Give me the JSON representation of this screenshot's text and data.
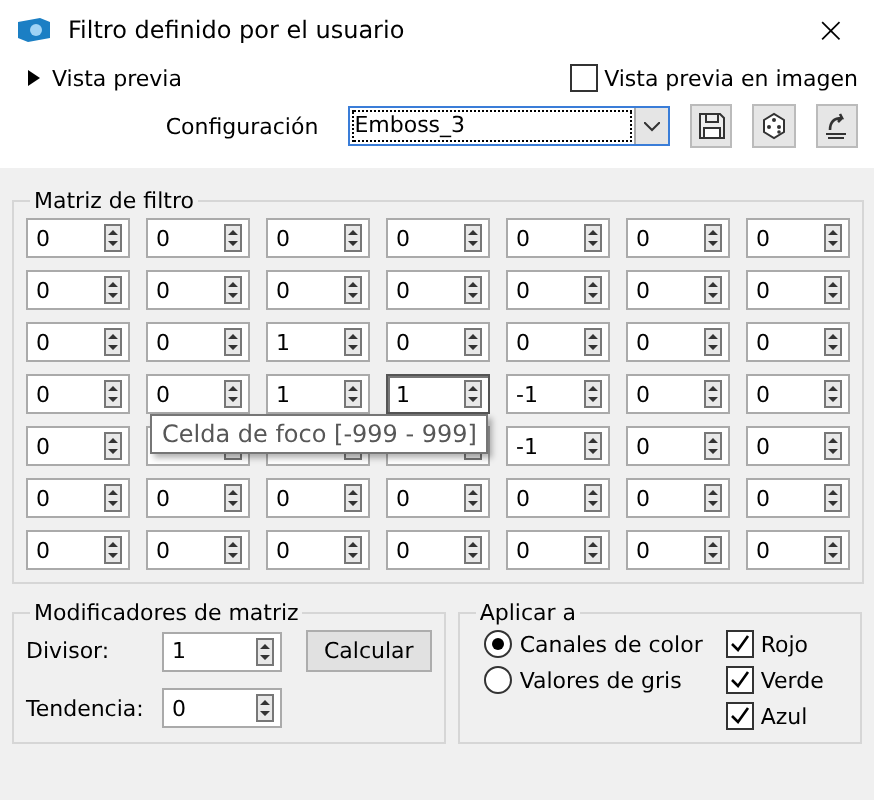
{
  "window": {
    "title": "Filtro definido por el usuario",
    "close": "×"
  },
  "preview": {
    "label": "Vista previa",
    "expanded": false
  },
  "image_preview": {
    "label": "Vista previa en imagen",
    "checked": false
  },
  "preset": {
    "label": "Configuración",
    "value": "Emboss_3"
  },
  "matrix": {
    "title": "Matriz de filtro",
    "rows": [
      [
        {
          "value": "0",
          "focused": false
        },
        {
          "value": "0",
          "focused": false
        },
        {
          "value": "0",
          "focused": false
        },
        {
          "value": "0",
          "focused": false
        },
        {
          "value": "0",
          "focused": false
        },
        {
          "value": "0",
          "focused": false
        },
        {
          "value": "0",
          "focused": false
        }
      ],
      [
        {
          "value": "0",
          "focused": false
        },
        {
          "value": "0",
          "focused": false
        },
        {
          "value": "0",
          "focused": false
        },
        {
          "value": "0",
          "focused": false
        },
        {
          "value": "0",
          "focused": false
        },
        {
          "value": "0",
          "focused": false
        },
        {
          "value": "0",
          "focused": false
        }
      ],
      [
        {
          "value": "0",
          "focused": false
        },
        {
          "value": "0",
          "focused": false
        },
        {
          "value": "1",
          "focused": false
        },
        {
          "value": "0",
          "focused": false
        },
        {
          "value": "0",
          "focused": false
        },
        {
          "value": "0",
          "focused": false
        },
        {
          "value": "0",
          "focused": false
        }
      ],
      [
        {
          "value": "0",
          "focused": false
        },
        {
          "value": "0",
          "focused": false
        },
        {
          "value": "1",
          "focused": false
        },
        {
          "value": "1",
          "focused": true
        },
        {
          "value": "-1",
          "focused": false
        },
        {
          "value": "0",
          "focused": false
        },
        {
          "value": "0",
          "focused": false
        }
      ],
      [
        {
          "value": "0",
          "focused": false
        },
        {
          "focused": false
        },
        {
          "focused": false
        },
        {
          "focused": false
        },
        {
          "value": "-1",
          "focused": false
        },
        {
          "value": "0",
          "focused": false
        },
        {
          "value": "0",
          "focused": false
        }
      ],
      [
        {
          "value": "0",
          "focused": false
        },
        {
          "value": "0",
          "focused": false
        },
        {
          "value": "0",
          "focused": false
        },
        {
          "value": "0",
          "focused": false
        },
        {
          "value": "0",
          "focused": false
        },
        {
          "value": "0",
          "focused": false
        },
        {
          "value": "0",
          "focused": false
        }
      ],
      [
        {
          "value": "0",
          "focused": false
        },
        {
          "value": "0",
          "focused": false
        },
        {
          "value": "0",
          "focused": false
        },
        {
          "value": "0",
          "focused": false
        },
        {
          "value": "0",
          "focused": false
        },
        {
          "value": "0",
          "focused": false
        },
        {
          "value": "0",
          "focused": false
        }
      ]
    ],
    "tooltip": "Celda de foco [-999 - 999]"
  },
  "modifiers": {
    "title": "Modificadores de matriz",
    "divisor_label": "Divisor:",
    "divisor": "1",
    "bias_label": "Tendencia:",
    "bias": "0",
    "calculate": "Calcular"
  },
  "apply_to": {
    "title": "Aplicar a",
    "modes": [
      {
        "label": "Canales de color",
        "selected": true
      },
      {
        "label": "Valores de gris",
        "selected": false
      }
    ],
    "channels": [
      {
        "label": "Rojo",
        "checked": true
      },
      {
        "label": "Verde",
        "checked": true
      },
      {
        "label": "Azul",
        "checked": true
      }
    ]
  }
}
